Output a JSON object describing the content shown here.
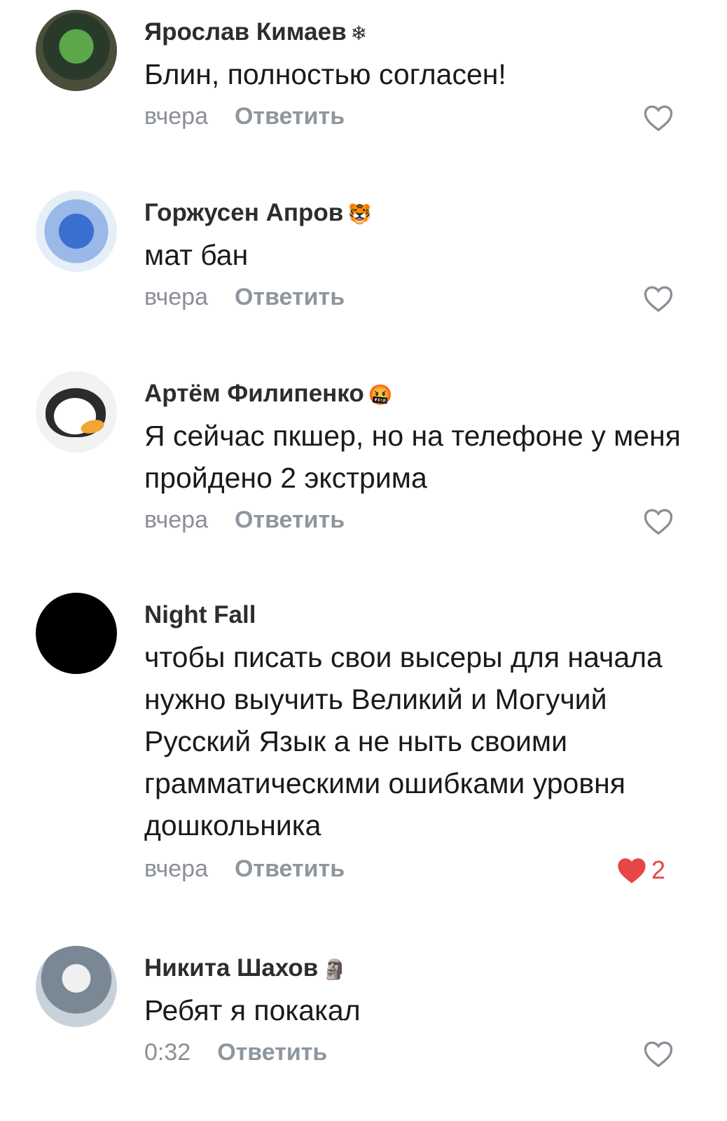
{
  "comments": [
    {
      "author": "Ярослав Кимаев",
      "badge": "❄",
      "text": "Блин, полностью согласен!",
      "time": "вчера",
      "reply_label": "Ответить",
      "liked": false,
      "like_count": ""
    },
    {
      "author": "Горжусен Апров",
      "badge": "🐯",
      "text": "мат бан",
      "time": "вчера",
      "reply_label": "Ответить",
      "liked": false,
      "like_count": ""
    },
    {
      "author": "Артём Филипенко",
      "badge": "🤬",
      "text": "Я сейчас пкшер, но на телефоне у меня пройдено 2 экстрима",
      "time": "вчера",
      "reply_label": "Ответить",
      "liked": false,
      "like_count": ""
    },
    {
      "author": "Night Fall",
      "badge": "",
      "text": "чтобы писать свои высеры для начала нужно выучить Великий и Могучий Русский Язык а не ныть своими грамматическими ошибками уровня дошкольника",
      "time": "вчера",
      "reply_label": "Ответить",
      "liked": true,
      "like_count": "2"
    },
    {
      "author": "Никита Шахов",
      "badge": "🗿",
      "text": "Ребят я покакал",
      "time": "0:32",
      "reply_label": "Ответить",
      "liked": false,
      "like_count": ""
    }
  ],
  "colors": {
    "like_active": "#e64646",
    "like_inactive": "#8a8f96"
  }
}
